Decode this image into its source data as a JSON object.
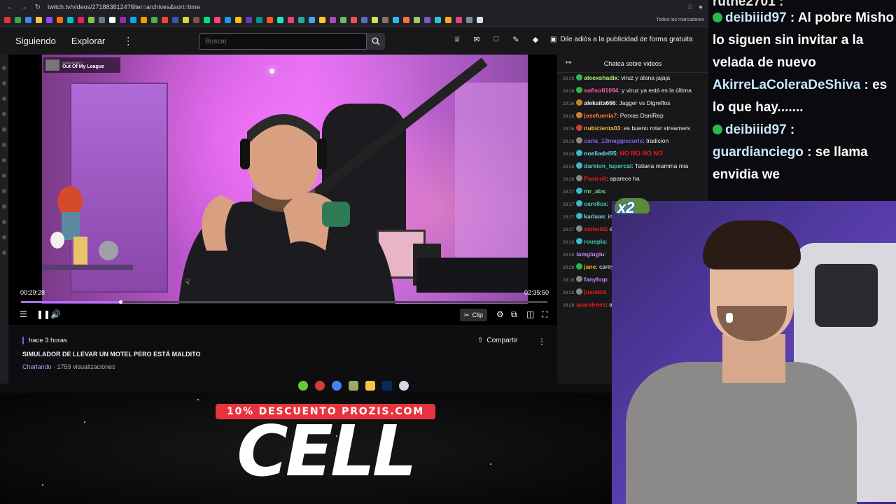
{
  "browser": {
    "url": "twitch.tv/videos/2718838124?filter=archives&sort=time",
    "bookmarks_label": "Todos los marcadores"
  },
  "nav": {
    "following": "Siguiendo",
    "browse": "Explorar",
    "search_placeholder": "Buscar",
    "ad_free": "Dile adiós a la publicidad de forma gratuita"
  },
  "player": {
    "song_artist": "AIDAN BISSETT",
    "song_title": "Out Of My League",
    "current_time": "00:29:28",
    "total_time": "02:35:50",
    "progress_fraction": 0.189,
    "clip_label": "Clip"
  },
  "video_info": {
    "ago": "hace 3 horas",
    "title": "SIMULADOR DE LLEVAR UN MOTEL PERO ESTÁ MALDITO",
    "category": "Charlando",
    "views": "1759 visualizaciones",
    "share_label": "Compartir"
  },
  "chat": {
    "header": "Chatea sobre videos",
    "messages": [
      {
        "time": "29:26",
        "user": "aleexshadix",
        "color": "#b8f27a",
        "badge": "#2db84d",
        "text": "viruz y alana jajaja"
      },
      {
        "time": "29:26",
        "user": "sofisofi1094",
        "color": "#ff5fa2",
        "badge": "#2db84d",
        "text": "y viruz ya está es la última"
      },
      {
        "time": "29:26",
        "user": "aleksita666",
        "color": "#efeff1",
        "badge": "#c9842b",
        "text": "Jagger vs Digreffos"
      },
      {
        "time": "29:26",
        "user": "josefuenla7",
        "color": "#ff7a3d",
        "badge": "#c9842b",
        "text": "Perxas DaniRep"
      },
      {
        "time": "29:26",
        "user": "nubicienta03",
        "color": "#ffb347",
        "badge": "#d23c3c",
        "text": "es bueno rotar streamers"
      },
      {
        "time": "29:26",
        "user": "carla_13maggiecurls",
        "color": "#8a5cf6",
        "badge": "#888888",
        "text": "tradicion"
      },
      {
        "time": "29:26",
        "user": "noeliadel95",
        "color": "#6fd6e8",
        "badge": "#3fb8c8",
        "text": "NO NO NO NO"
      },
      {
        "time": "29:26",
        "user": "darkion_lupercal",
        "color": "#3fd0b0",
        "badge": "#3fb8c8",
        "text": "Tatiana mamma mia"
      },
      {
        "time": "29:26",
        "user": "Paaico0",
        "color": "#e91916",
        "badge": "#888888",
        "text": "aparece ha"
      },
      {
        "time": "29:27",
        "user": "mr_abs",
        "color": "#5fe07a",
        "badge": "#3fb8c8",
        "text": ""
      },
      {
        "time": "29:27",
        "user": "caro8ca",
        "color": "#3fd0b0",
        "badge": "#3fb8c8",
        "text": ""
      },
      {
        "time": "29:27",
        "user": "karlaan",
        "color": "#6fd6e8",
        "badge": "#3fb8c8",
        "text": "imagen, si"
      },
      {
        "time": "29:27",
        "user": "xamuii2",
        "color": "#e91916",
        "badge": "#888888",
        "text": "épico"
      },
      {
        "time": "29:28",
        "user": "rouspla",
        "color": "#3fd0b0",
        "badge": "#3fb8c8",
        "text": ""
      },
      {
        "time": "29:28",
        "user": "iamgiugiu",
        "color": "#c08cff",
        "badge": "",
        "text": ""
      },
      {
        "time": "29:28",
        "user": "jane",
        "color": "#f5a623",
        "badge": "#2db84d",
        "text": "carey de la"
      },
      {
        "time": "29:28",
        "user": "fanyhop",
        "color": "#c08cff",
        "badge": "#888888",
        "text": ""
      },
      {
        "time": "29:28",
        "user": "juandbi",
        "color": "#e91916",
        "badge": "#888888",
        "text": ""
      },
      {
        "time": "29:28",
        "user": "aaandreee",
        "color": "#e91916",
        "badge": "",
        "text": "año??"
      }
    ]
  },
  "overlay_chat": [
    {
      "user": "deibiiid97",
      "text": "Al pobre Misho lo siguen sin invitar a la velada de nuevo"
    },
    {
      "user": "AkirreLaColeraDeShiva",
      "text": "es lo que hay......."
    },
    {
      "user": "deibiiid97",
      "text": ""
    },
    {
      "user": "guardianciego",
      "text": "se llama envidia we"
    }
  ],
  "overlay_partial_top": "ruthe2701 :",
  "emote_text": "x2",
  "promo": {
    "pill": "10% DESCUENTO PROZIS.COM",
    "big": "CELL"
  }
}
